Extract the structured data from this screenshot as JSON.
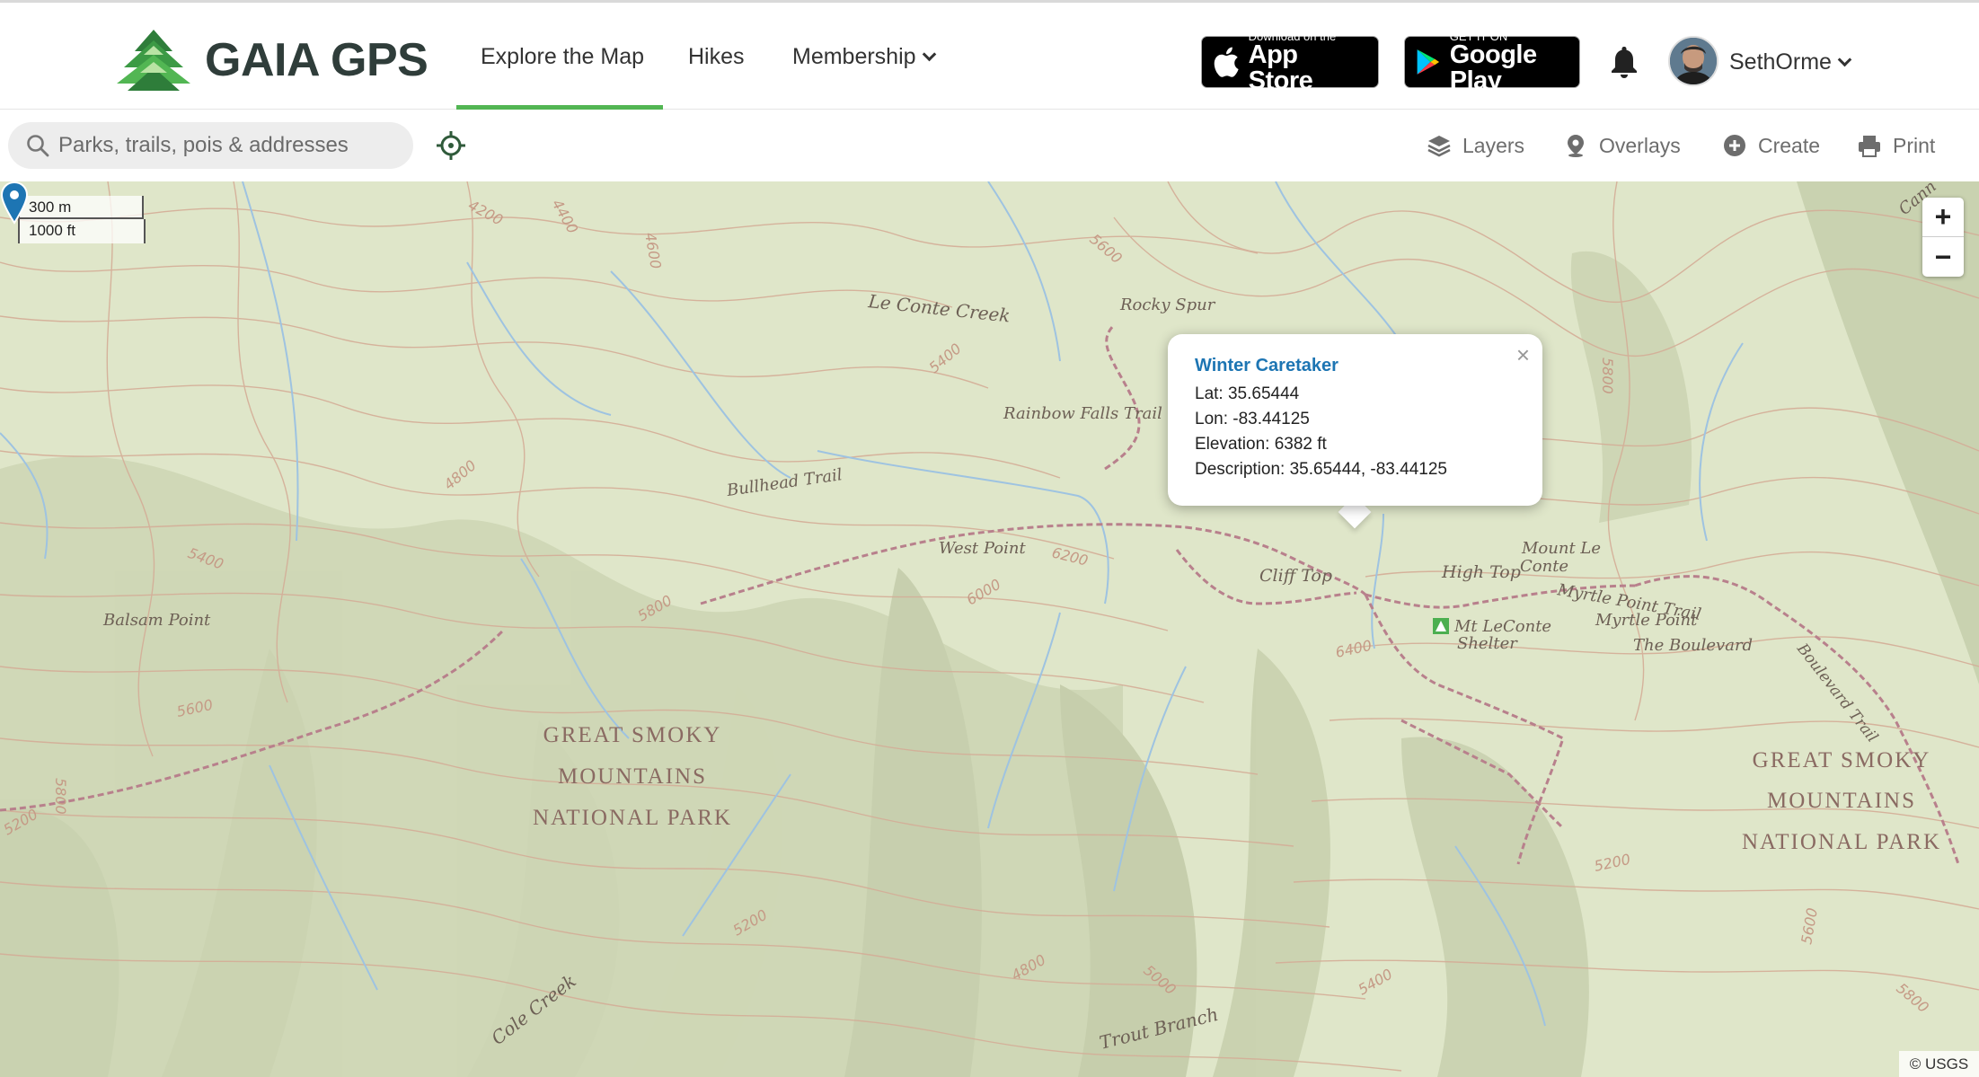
{
  "header": {
    "logo_text": "GAIA GPS",
    "nav": {
      "explore": "Explore the Map",
      "hikes": "Hikes",
      "membership": "Membership"
    },
    "appstore": {
      "small": "Download on the",
      "big": "App Store"
    },
    "googleplay": {
      "small": "GET IT ON",
      "big": "Google Play"
    },
    "username": "SethOrme",
    "accent_color": "#52b653"
  },
  "toolbar": {
    "search_placeholder": "Parks, trails, pois & addresses",
    "layers": "Layers",
    "overlays": "Overlays",
    "create": "Create",
    "print": "Print"
  },
  "map": {
    "scale_metric": "300 m",
    "scale_imperial": "1000 ft",
    "zoom_in": "+",
    "zoom_out": "−",
    "attribution": "© USGS",
    "labels": {
      "le_conte_creek": "Le Conte Creek",
      "rocky_spur": "Rocky Spur",
      "rainbow_falls_trail": "Rainbow Falls Trail",
      "bullhead_trail": "Bullhead Trail",
      "west_point": "West Point",
      "cliff_top": "Cliff Top",
      "high_top": "High Top",
      "mount_le_conte_1": "Mount Le",
      "mount_le_conte_2": "Conte",
      "myrtle_point_trail": "Myrtle Point Trail",
      "myrtle_point": "Myrtle Point",
      "the_boulevard": "The Boulevard",
      "boulevard_trail": "Boulevard Trail",
      "shelter_1": "Mt LeConte",
      "shelter_2": "Shelter",
      "balsam_point": "Balsam Point",
      "park_left": [
        "GREAT SMOKY",
        "MOUNTAINS",
        "NATIONAL PARK"
      ],
      "park_right": [
        "GREAT SMOKY",
        "MOUNTAINS",
        "NATIONAL PARK"
      ],
      "cole_creek": "Cole Creek",
      "trout_branch": "Trout Branch",
      "cutoff_top_right": "Cann"
    },
    "contour_labels": [
      "4200",
      "4400",
      "4600",
      "5600",
      "5400",
      "4800",
      "5400",
      "6200",
      "6000",
      "5800",
      "6400",
      "5600",
      "5200",
      "5800",
      "5200",
      "4800",
      "5000",
      "5400",
      "5600",
      "5800",
      "5200",
      "5800"
    ]
  },
  "popup": {
    "title": "Winter Caretaker",
    "lat": "Lat: 35.65444",
    "lon": "Lon: -83.44125",
    "elevation": "Elevation: 6382 ft",
    "description": "Description: 35.65444, -83.44125",
    "close": "×",
    "title_color": "#1d75b3",
    "marker_color": "#1d75b3"
  }
}
